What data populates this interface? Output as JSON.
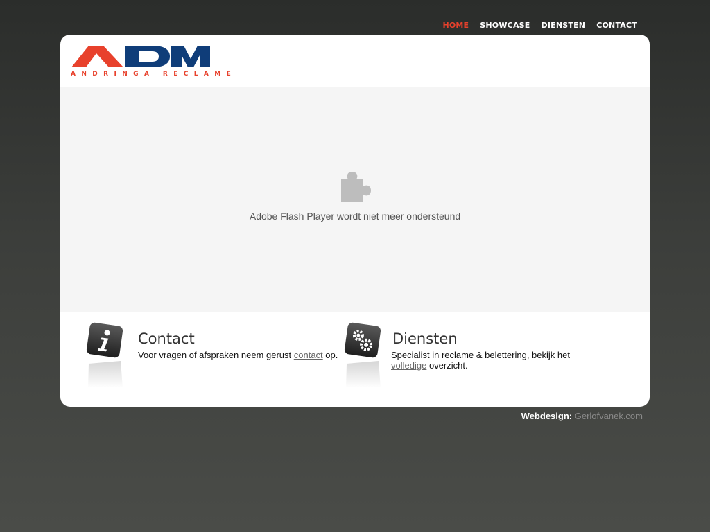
{
  "nav": {
    "items": [
      {
        "label": "HOME",
        "active": true
      },
      {
        "label": "SHOWCASE",
        "active": false
      },
      {
        "label": "DIENSTEN",
        "active": false
      },
      {
        "label": "CONTACT",
        "active": false
      }
    ],
    "active_color": "#e8412c"
  },
  "logo": {
    "text": "ADM",
    "tagline": "ANDRINGA RECLAME",
    "colors": {
      "red": "#e8412c",
      "blue": "#0f3d79"
    }
  },
  "flash": {
    "icon": "puzzle-piece-icon",
    "message": "Adobe Flash Player wordt niet meer ondersteund"
  },
  "contact": {
    "icon": "info-icon",
    "title": "Contact",
    "text_before": "Voor vragen of afspraken neem gerust ",
    "link": "contact",
    "text_after": " op."
  },
  "diensten": {
    "icon": "gears-icon",
    "title": "Diensten",
    "text_before": "Specialist in reclame & belettering, bekijk het ",
    "link": "volledige",
    "text_after": " overzicht."
  },
  "footer": {
    "label": "Webdesign:",
    "link": "Gerlofvanek.com"
  }
}
